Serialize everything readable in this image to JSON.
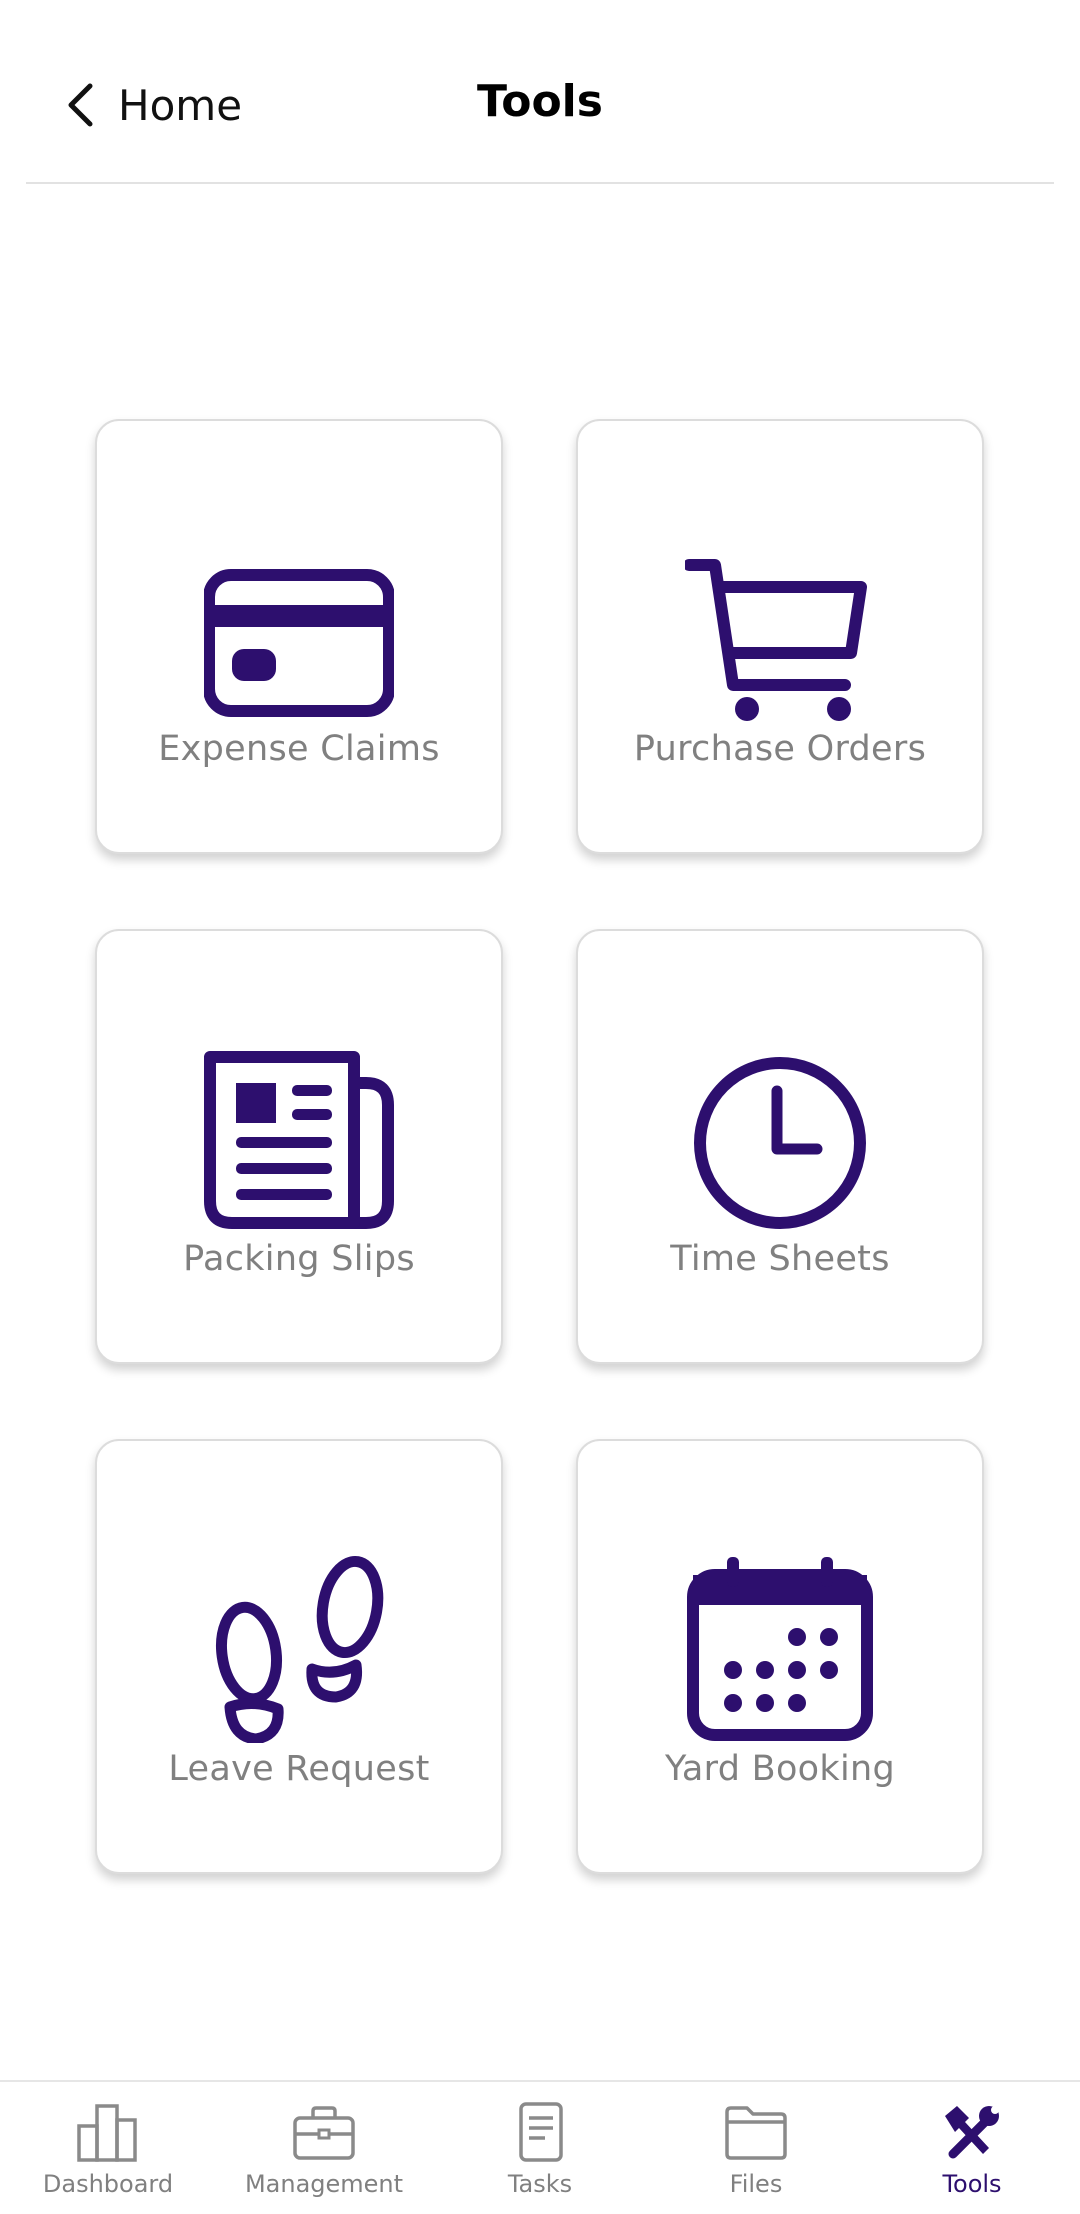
{
  "header": {
    "back_label": "Home",
    "title": "Tools"
  },
  "tools": [
    {
      "label": "Expense Claims",
      "icon": "credit-card-icon"
    },
    {
      "label": "Purchase Orders",
      "icon": "shopping-cart-icon"
    },
    {
      "label": "Packing Slips",
      "icon": "newspaper-icon"
    },
    {
      "label": "Time Sheets",
      "icon": "clock-icon"
    },
    {
      "label": "Leave Request",
      "icon": "footprints-icon"
    },
    {
      "label": "Yard Booking",
      "icon": "calendar-icon"
    }
  ],
  "bottom_nav": [
    {
      "label": "Dashboard",
      "icon": "bar-chart-icon",
      "active": false
    },
    {
      "label": "Management",
      "icon": "briefcase-icon",
      "active": false
    },
    {
      "label": "Tasks",
      "icon": "document-icon",
      "active": false
    },
    {
      "label": "Files",
      "icon": "folder-icon",
      "active": false
    },
    {
      "label": "Tools",
      "icon": "tools-icon",
      "active": true
    }
  ],
  "colors": {
    "accent": "#2d0f6e",
    "label_gray": "#808080",
    "nav_inactive": "#8a8a8a"
  }
}
